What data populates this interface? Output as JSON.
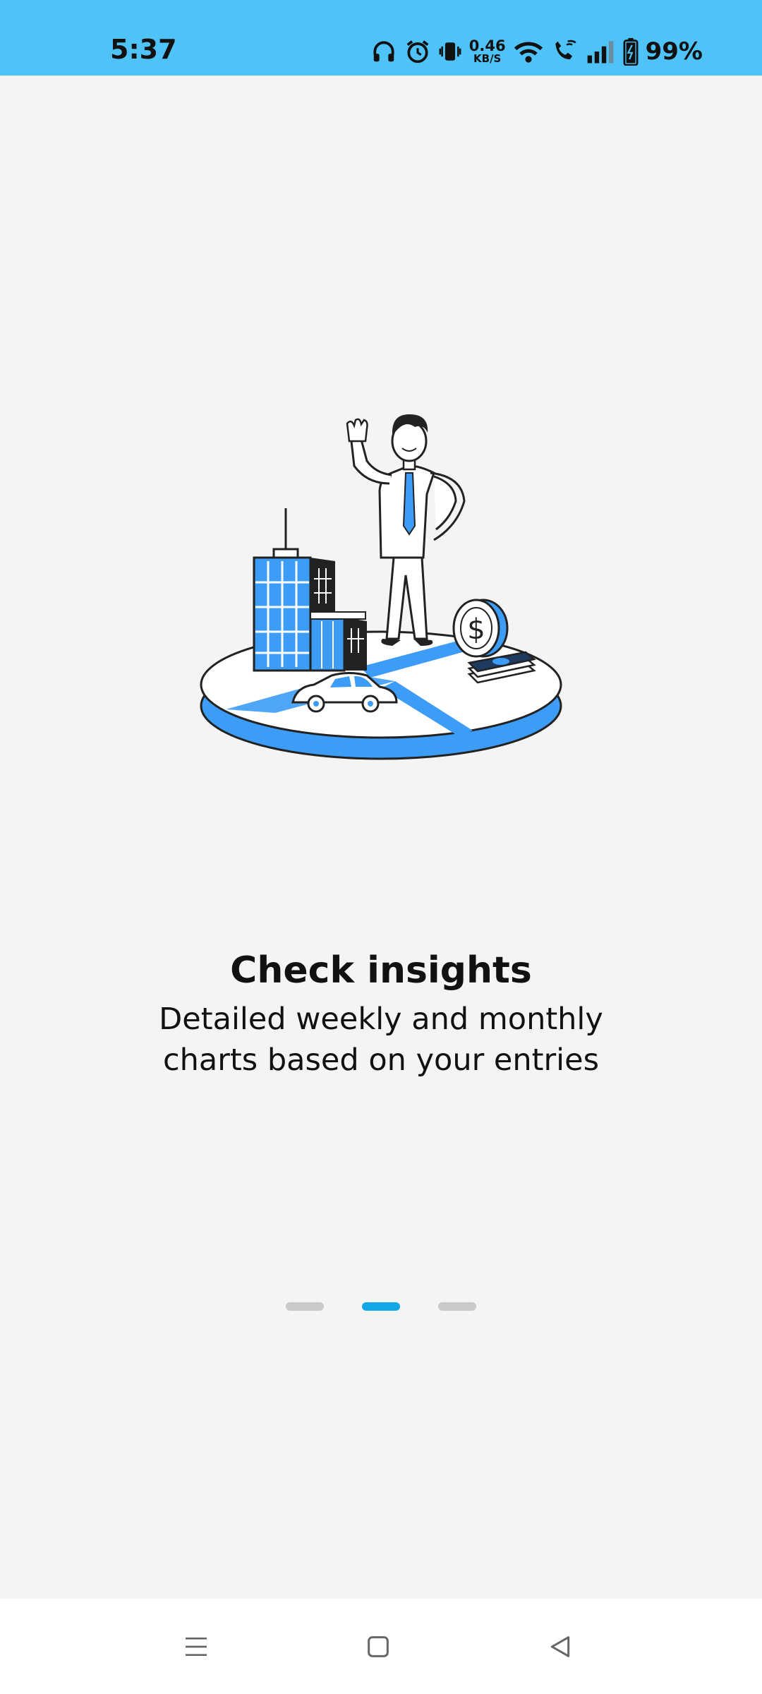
{
  "status_bar": {
    "time": "5:37",
    "net_speed_value": "0.46",
    "net_speed_unit": "KB/S",
    "battery_percent": "99%",
    "icons": [
      "headphones-icon",
      "alarm-icon",
      "vibrate-icon",
      "wifi-icon",
      "wifi-calling-icon",
      "signal-icon",
      "battery-icon"
    ],
    "background_color": "#4fc3f7"
  },
  "onboarding": {
    "title": "Check insights",
    "subtitle_line1": "Detailed weekly and monthly",
    "subtitle_line2": "charts based on your entries",
    "illustration": "man-standing-on-city-pie-chart-illustration",
    "accent_color": "#3d9cf5"
  },
  "pager": {
    "page_count": 3,
    "active_index": 1,
    "active_color": "#12a8e8",
    "inactive_color": "#c9c9c9"
  },
  "nav_bar": {
    "buttons": [
      "menu-icon",
      "home-icon",
      "back-icon"
    ]
  }
}
